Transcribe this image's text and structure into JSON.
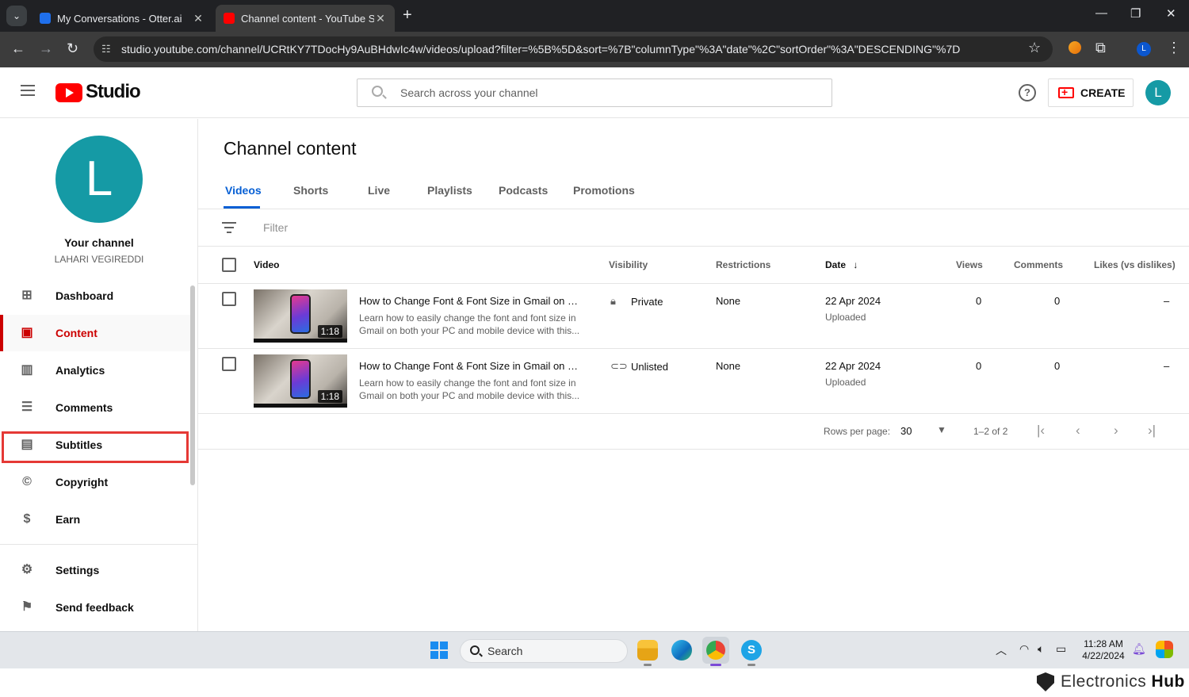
{
  "browser": {
    "tabs": [
      {
        "title": "My Conversations - Otter.ai",
        "close": "✕"
      },
      {
        "title": "Channel content - YouTube Studio",
        "close": "✕"
      }
    ],
    "url": "studio.youtube.com/channel/UCRtKY7TDocHy9AuBHdwIc4w/videos/upload?filter=%5B%5D&sort=%7B\"columnType\"%3A\"date\"%2C\"sortOrder\"%3A\"DESCENDING\"%7D",
    "profile_initial": "L"
  },
  "header": {
    "logo_text": "Studio",
    "search_placeholder": "Search across your channel",
    "help_glyph": "?",
    "create_label": "CREATE",
    "avatar_initial": "L"
  },
  "sidebar": {
    "avatar_initial": "L",
    "channel_title": "Your channel",
    "channel_name": "LAHARI VEGIREDDI",
    "items": [
      {
        "label": "Dashboard",
        "icon": "dashboard-icon"
      },
      {
        "label": "Content",
        "icon": "content-icon"
      },
      {
        "label": "Analytics",
        "icon": "analytics-icon"
      },
      {
        "label": "Comments",
        "icon": "comments-icon"
      },
      {
        "label": "Subtitles",
        "icon": "subtitles-icon"
      },
      {
        "label": "Copyright",
        "icon": "copyright-icon"
      },
      {
        "label": "Earn",
        "icon": "earn-icon"
      }
    ],
    "settings_label": "Settings",
    "feedback_label": "Send feedback",
    "active_item": "Content",
    "highlighted_item": "Subtitles"
  },
  "main": {
    "title": "Channel content",
    "tabs": [
      "Videos",
      "Shorts",
      "Live",
      "Playlists",
      "Podcasts",
      "Promotions"
    ],
    "active_tab": "Videos",
    "filter_label": "Filter",
    "columns": {
      "video": "Video",
      "visibility": "Visibility",
      "restrictions": "Restrictions",
      "date": "Date",
      "views": "Views",
      "comments": "Comments",
      "likes": "Likes (vs dislikes)"
    },
    "rows": [
      {
        "duration": "1:18",
        "title": "How to Change Font & Font Size in Gmail on both your PC and mobile device",
        "description": "Learn how to easily change the font and font size in Gmail on both your PC and mobile device with this...",
        "visibility": "Private",
        "visibility_icon": "lock-icon",
        "restrictions": "None",
        "date": "22 Apr 2024",
        "date_status": "Uploaded",
        "views": "0",
        "comments": "0",
        "likes": "–"
      },
      {
        "duration": "1:18",
        "title": "How to Change Font & Font Size in Gmail on both your PC and mobile device",
        "description": "Learn how to easily change the font and font size in Gmail on both your PC and mobile device with this...",
        "visibility": "Unlisted",
        "visibility_icon": "link-icon",
        "restrictions": "None",
        "date": "22 Apr 2024",
        "date_status": "Uploaded",
        "views": "0",
        "comments": "0",
        "likes": "–"
      }
    ],
    "pagination": {
      "rows_per_page_label": "Rows per page:",
      "rows_per_page": "30",
      "range": "1–2 of 2"
    }
  },
  "taskbar": {
    "search_label": "Search",
    "time": "11:28 AM",
    "date": "4/22/2024"
  },
  "watermark": {
    "brand_light": "Electronics",
    "brand_bold": "Hub"
  },
  "colors": {
    "accent_blue": "#065fd4",
    "active_red": "#cc0000",
    "avatar_teal": "#159aa5",
    "highlight_red": "#e53935"
  }
}
